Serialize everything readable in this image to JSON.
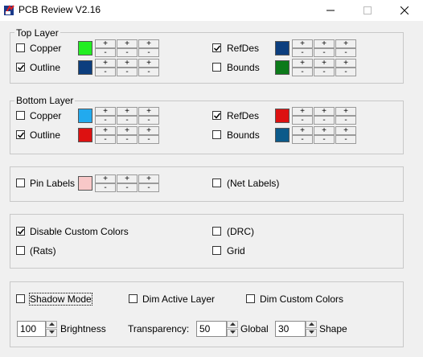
{
  "window": {
    "title": "PCB Review V2.16"
  },
  "pm": {
    "plus": "+",
    "minus": "-"
  },
  "top_layer": {
    "title": "Top Layer",
    "copper": {
      "label": "Copper",
      "checked": false,
      "color": "#22ee22"
    },
    "outline": {
      "label": "Outline",
      "checked": true,
      "color": "#0c3e7e"
    },
    "refdes": {
      "label": "RefDes",
      "checked": true,
      "color": "#0c3e7e"
    },
    "bounds": {
      "label": "Bounds",
      "checked": false,
      "color": "#0c7a1a"
    }
  },
  "bottom_layer": {
    "title": "Bottom Layer",
    "copper": {
      "label": "Copper",
      "checked": false,
      "color": "#22aaee"
    },
    "outline": {
      "label": "Outline",
      "checked": true,
      "color": "#dd1111"
    },
    "refdes": {
      "label": "RefDes",
      "checked": true,
      "color": "#dd1111"
    },
    "bounds": {
      "label": "Bounds",
      "checked": false,
      "color": "#0c5a8a"
    }
  },
  "labels_group": {
    "pin_labels": {
      "label": "Pin Labels",
      "checked": false,
      "color": "#f8c8c8"
    },
    "net_labels": {
      "label": "(Net Labels)",
      "checked": false
    }
  },
  "options_group": {
    "disable_custom_colors": {
      "label": "Disable Custom Colors",
      "checked": true
    },
    "drc": {
      "label": "(DRC)",
      "checked": false
    },
    "rats": {
      "label": "(Rats)",
      "checked": false
    },
    "grid": {
      "label": "Grid",
      "checked": false
    }
  },
  "display_group": {
    "shadow_mode": {
      "label": "Shadow Mode",
      "checked": false
    },
    "dim_active_layer": {
      "label": "Dim Active Layer",
      "checked": false
    },
    "dim_custom_colors": {
      "label": "Dim Custom Colors",
      "checked": false
    },
    "brightness": {
      "value": "100",
      "label": "Brightness"
    },
    "transparency_label": "Transparency:",
    "global": {
      "value": "50",
      "label": "Global"
    },
    "shape": {
      "value": "30",
      "label": "Shape"
    }
  }
}
